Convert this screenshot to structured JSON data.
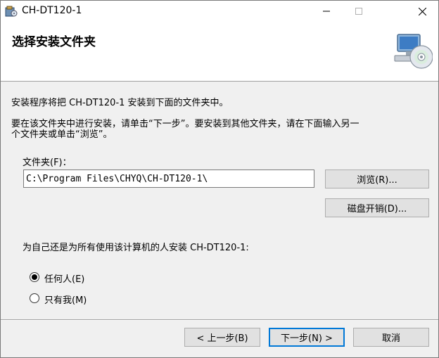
{
  "window": {
    "title": "CH-DT120-1",
    "controls": {
      "minimize": "—",
      "maximize": "☐",
      "close": "✕"
    }
  },
  "header": {
    "title": "选择安装文件夹",
    "icon": "computer-cd-icon"
  },
  "body": {
    "line1": "安装程序将把 CH-DT120-1 安装到下面的文件夹中。",
    "line2": "要在该文件夹中进行安装，请单击“下一步”。要安装到其他文件夹，请在下面输入另一",
    "line3": "个文件夹或单击“浏览”。",
    "folder_label": "文件夹(F)：",
    "folder_value": "C:\\Program Files\\CHYQ\\CH-DT120-1\\",
    "browse_button": "浏览(R)...",
    "disk_cost_button": "磁盘开销(D)...",
    "install_for_label": "为自己还是为所有使用该计算机的人安装 CH-DT120-1:",
    "radio_everyone": "任何人(E)",
    "radio_just_me": "只有我(M)",
    "selected_option": "everyone"
  },
  "footer": {
    "back_button": "< 上一步(B)",
    "next_button": "下一步(N) >",
    "cancel_button": "取消"
  }
}
